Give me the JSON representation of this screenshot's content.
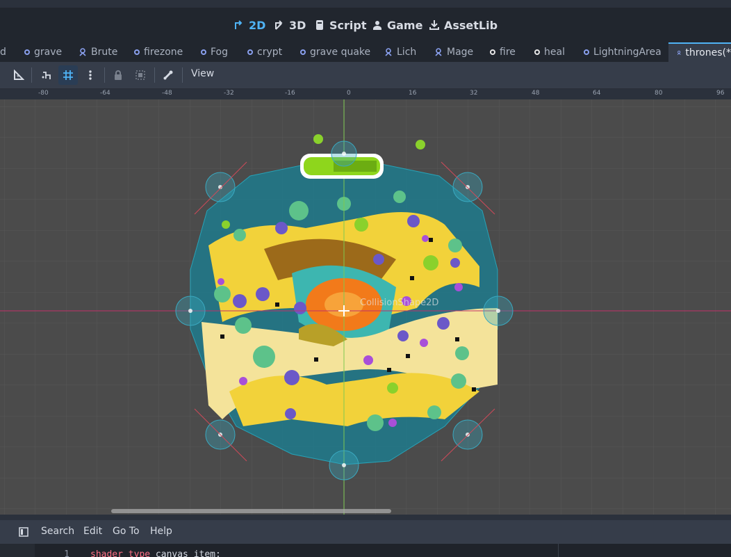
{
  "workspace": {
    "items": [
      {
        "label": "2D",
        "icon": "2d-icon",
        "active": true
      },
      {
        "label": "3D",
        "icon": "3d-icon",
        "active": false
      },
      {
        "label": "Script",
        "icon": "script-icon",
        "active": false
      },
      {
        "label": "Game",
        "icon": "game-icon",
        "active": false
      },
      {
        "label": "AssetLib",
        "icon": "assetlib-icon",
        "active": false
      }
    ],
    "accent": "#4fb3f5"
  },
  "tabs": [
    {
      "label": "d",
      "icon": "none"
    },
    {
      "label": "grave",
      "icon": "circle-icon"
    },
    {
      "label": "Brute",
      "icon": "node-icon"
    },
    {
      "label": "firezone",
      "icon": "circle-icon"
    },
    {
      "label": "Fog",
      "icon": "circle-icon"
    },
    {
      "label": "crypt",
      "icon": "circle-icon"
    },
    {
      "label": "grave quake",
      "icon": "circle-icon"
    },
    {
      "label": "Lich",
      "icon": "node-icon"
    },
    {
      "label": "Mage",
      "icon": "node-icon"
    },
    {
      "label": "fire",
      "icon": "circle-white-icon"
    },
    {
      "label": "heal",
      "icon": "circle-white-icon"
    },
    {
      "label": "LightningArea",
      "icon": "circle-icon"
    },
    {
      "label": "thrones(*",
      "icon": "node-icon",
      "active": true
    }
  ],
  "toolbar": {
    "view_label": "View"
  },
  "ruler": {
    "ticks": [
      "-80",
      "-64",
      "-48",
      "-32",
      "-16",
      "0",
      "16",
      "32",
      "48",
      "64",
      "80",
      "96"
    ]
  },
  "viewport": {
    "node_label": "CollisionShape2D",
    "background": "#4b4b4b",
    "shape_color": "#1f7a8c",
    "x_axis_color": "#c0306a",
    "y_axis_color": "#7ec850"
  },
  "script_menu": {
    "items": [
      "Search",
      "Edit",
      "Go To",
      "Help"
    ]
  },
  "code": {
    "line_number": "1",
    "keyword1": "shader_type",
    "rest": " canvas_item;"
  }
}
